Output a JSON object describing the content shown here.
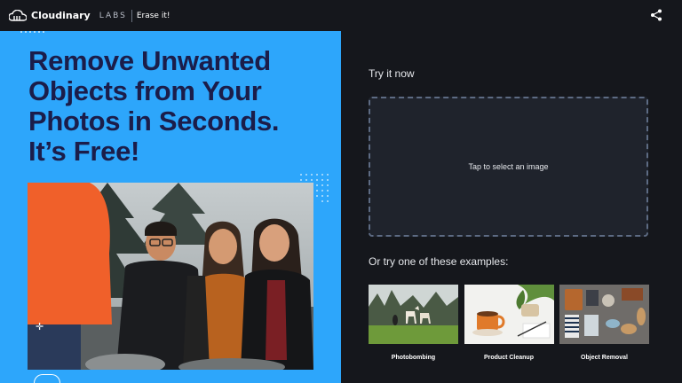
{
  "header": {
    "brand": "Cloudinary",
    "labs": "LABS",
    "product": "Erase it!",
    "share_icon": "share-icon"
  },
  "hero": {
    "headline_lines": [
      "Remove Unwanted",
      "Objects from Your",
      "Photos in Seconds.",
      "It’s Free!"
    ],
    "colors": {
      "background": "#2da6fb",
      "headline": "#1b1d4a"
    },
    "photo_icon": "people-laughing-photo"
  },
  "upload": {
    "try_label": "Try it now",
    "dropzone_label": "Tap to select an image"
  },
  "examples": {
    "heading": "Or try one of these examples:",
    "items": [
      {
        "label": "Photobombing",
        "icon": "field-horses-photo"
      },
      {
        "label": "Product Cleanup",
        "icon": "coffee-mug-plant-photo"
      },
      {
        "label": "Object Removal",
        "icon": "flat-lay-items-photo"
      }
    ]
  }
}
